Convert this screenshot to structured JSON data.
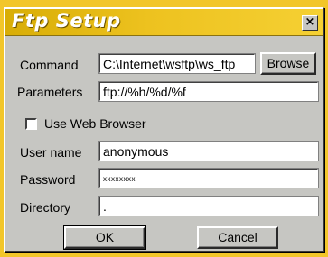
{
  "dialog": {
    "title": "Ftp Setup",
    "close_glyph": "×"
  },
  "fields": {
    "command": {
      "label": "Command",
      "value": "C:\\Internet\\wsftp\\ws_ftp"
    },
    "parameters": {
      "label": "Parameters",
      "value": "ftp://%h/%d/%f"
    },
    "username": {
      "label": "User name",
      "value": "anonymous"
    },
    "password": {
      "label": "Password",
      "value": "xxxxxxxx"
    },
    "directory": {
      "label": "Directory",
      "value": "."
    }
  },
  "use_web_browser": {
    "label": "Use Web Browser",
    "checked": false
  },
  "buttons": {
    "browse": "Browse",
    "ok": "OK",
    "cancel": "Cancel"
  },
  "colors": {
    "titlebar": "#edc21f",
    "title_text": "#ffffff",
    "dialog_face": "#c6c6c2",
    "background": "#f2c62a"
  }
}
